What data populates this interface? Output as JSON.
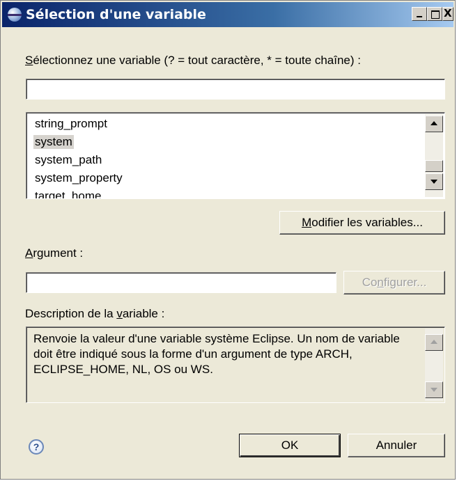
{
  "window": {
    "title": "Sélection d'une variable",
    "controls": {
      "minimize": "_",
      "maximize": "□",
      "close": "X"
    }
  },
  "filter": {
    "label_mnemonic": "S",
    "label_rest": "électionnez une variable (? = tout caractère, * = toute chaîne) :",
    "value": ""
  },
  "variables": {
    "items": [
      "string_prompt",
      "system",
      "system_path",
      "system_property",
      "target_home"
    ],
    "selected": "system",
    "scroll_position": 0.82
  },
  "buttons": {
    "edit_mnemonic": "M",
    "edit_rest": "odifier les variables...",
    "configure_pre": "Co",
    "configure_mnemonic": "n",
    "configure_post": "figurer...",
    "ok": "OK",
    "cancel": "Annuler"
  },
  "argument": {
    "label_mnemonic": "A",
    "label_rest": "rgument :",
    "value": ""
  },
  "description": {
    "label_pre": "Description de la ",
    "label_mnemonic": "v",
    "label_post": "ariable :",
    "text": "Renvoie la valeur d'une variable système Eclipse. Un nom de variable doit être indiqué sous la forme d'un argument de type ARCH, ECLIPSE_HOME, NL, OS ou WS."
  },
  "help_glyph": "?",
  "icons": [
    "eclipse-icon",
    "help-icon",
    "scroll-up-arrow-icon",
    "scroll-down-arrow-icon"
  ]
}
